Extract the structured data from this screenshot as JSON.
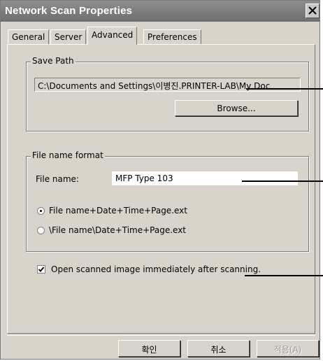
{
  "window": {
    "title": "Network Scan Properties"
  },
  "tabs": [
    {
      "label": "General"
    },
    {
      "label": "Server"
    },
    {
      "label": "Advanced"
    },
    {
      "label": "Preferences"
    }
  ],
  "save_path": {
    "group_label": "Save Path",
    "path_value": "C:\\Documents and Settings\\이병진.PRINTER-LAB\\My Doc",
    "browse_label": "Browse..."
  },
  "file_name_format": {
    "group_label": "File name format",
    "file_name_label": "File name:",
    "file_name_value": "MFP Type 103",
    "options": [
      {
        "label": "File name+Date+Time+Page.ext",
        "selected": true
      },
      {
        "label": "\\File name\\Date+Time+Page.ext",
        "selected": false
      }
    ]
  },
  "open_after_scan": {
    "label": "Open scanned image immediately after scanning.",
    "checked": true
  },
  "buttons": {
    "ok": "확인",
    "cancel": "취소",
    "apply": "적용(A)"
  }
}
